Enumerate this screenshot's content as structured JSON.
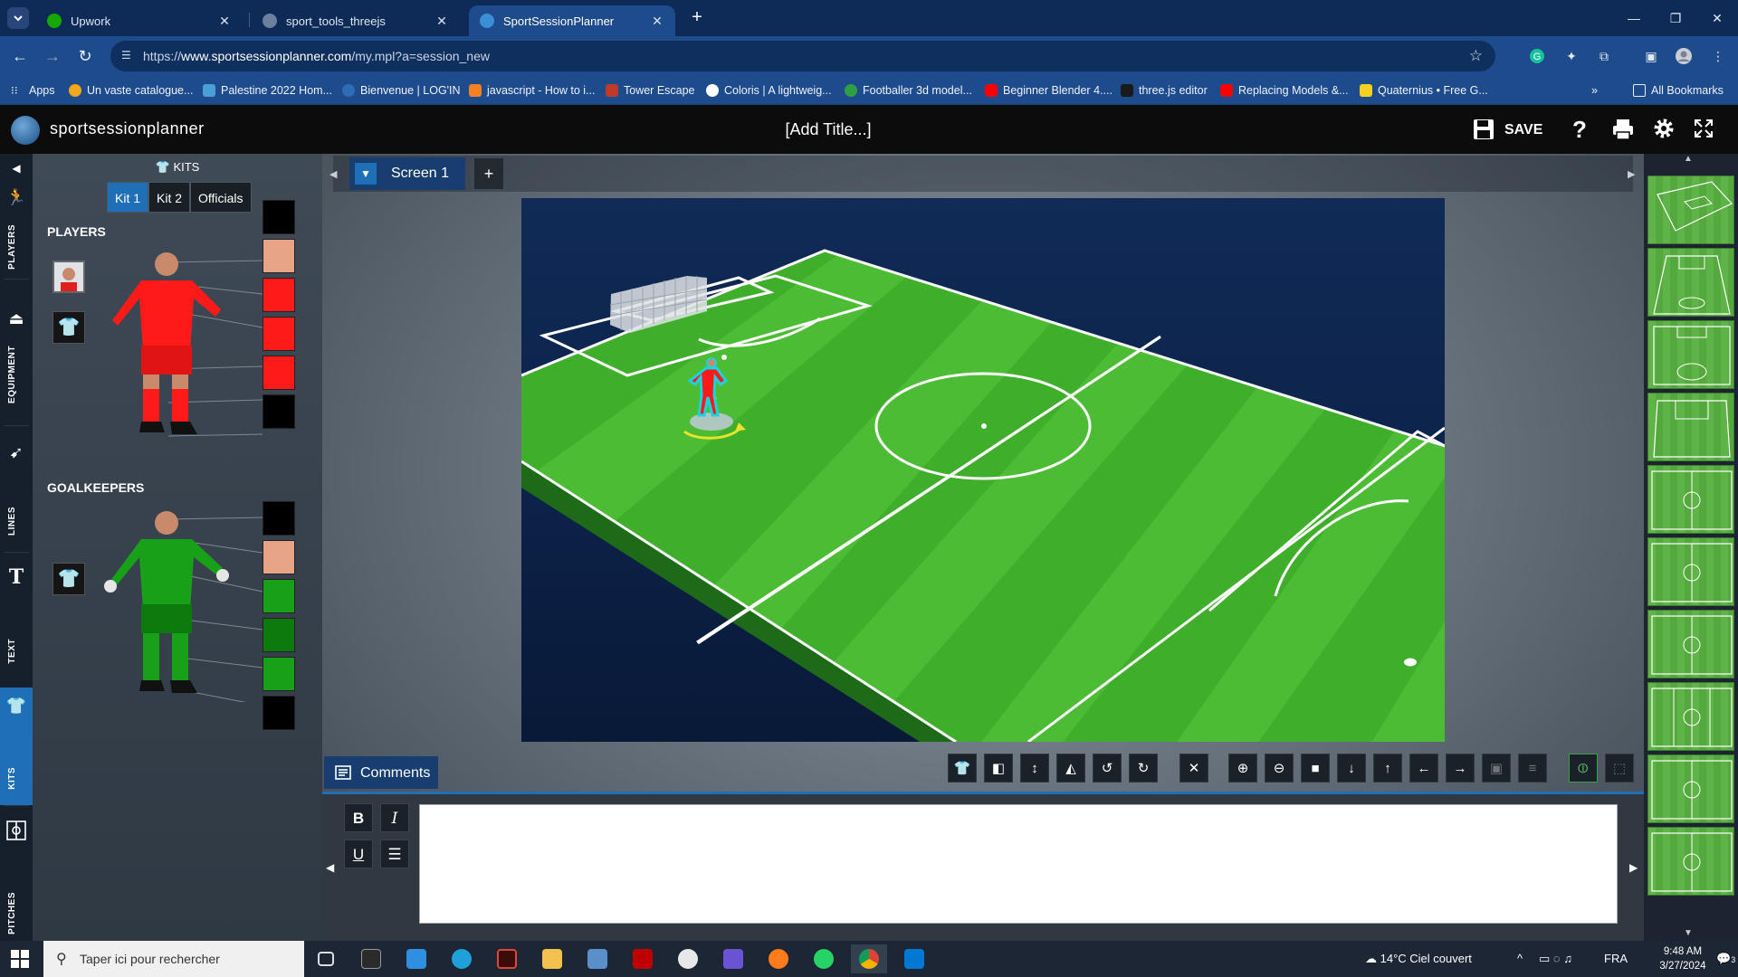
{
  "browser": {
    "tabs": [
      {
        "title": "Upwork",
        "active": false
      },
      {
        "title": "sport_tools_threejs",
        "active": false
      },
      {
        "title": "SportSessionPlanner",
        "active": true
      }
    ],
    "url_prefix": "https://",
    "url_host": "www.sportsessionplanner.com",
    "url_path": "/my.mpl?a=session_new",
    "bookmarks": [
      "Apps",
      "Un vaste catalogue...",
      "Palestine 2022 Hom...",
      "Bienvenue | LOG'IN",
      "javascript - How to i...",
      "Tower Escape",
      "Coloris | A lightweig...",
      "Footballer 3d model...",
      "Beginner Blender 4....",
      "three.js editor",
      "Replacing Models &...",
      "Quaternius • Free G...",
      "All Bookmarks"
    ],
    "more_bookmarks": "»"
  },
  "app": {
    "logo_text": "sportsessionplanner",
    "title": "[Add Title...]",
    "save_label": "SAVE"
  },
  "rail": {
    "items": [
      "PLAYERS",
      "EQUIPMENT",
      "LINES",
      "TEXT",
      "KITS",
      "PITCHES"
    ]
  },
  "kits": {
    "header": "KITS",
    "tabs": [
      "Kit 1",
      "Kit 2",
      "Officials"
    ],
    "players_label": "PLAYERS",
    "goalkeepers_label": "GOALKEEPERS",
    "player_swatches": [
      "#000000",
      "#e8a487",
      "#ff1a1a",
      "#ff1a1a",
      "#ff1a1a",
      "#000000"
    ],
    "goalkeeper_swatches": [
      "#000000",
      "#e8a487",
      "#18a018",
      "#0d7a0d",
      "#18a018",
      "#000000"
    ]
  },
  "stage": {
    "screen_label": "Screen 1",
    "add_label": "+"
  },
  "comments": {
    "label": "Comments",
    "format_buttons": [
      "B",
      "I",
      "U",
      "list"
    ]
  },
  "colors": {
    "accent": "#1f6fb6",
    "pitch_green": "#3fae2a",
    "tabbar": "#0e2a57"
  },
  "taskbar": {
    "search_placeholder": "Taper ici pour rechercher",
    "weather": "14°C  Ciel couvert",
    "lang": "FRA",
    "time": "9:48 AM",
    "date": "3/27/2024",
    "notifications": "3"
  }
}
